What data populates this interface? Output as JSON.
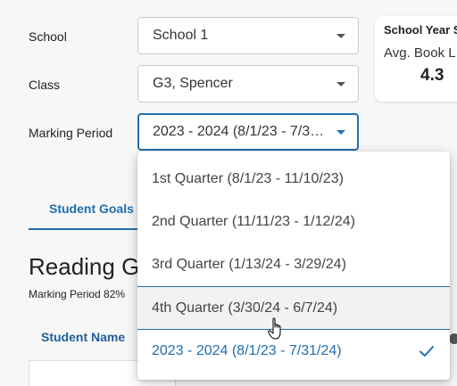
{
  "filters": {
    "school": {
      "label": "School",
      "value": "School 1"
    },
    "class": {
      "label": "Class",
      "value": "G3, Spencer"
    },
    "marking_period": {
      "label": "Marking Period",
      "value": "2023 - 2024 (8/1/23 - 7/31/24)"
    }
  },
  "summary_card": {
    "title": "School Year S",
    "subtitle": "Avg. Book L",
    "value": "4.3"
  },
  "tabs": {
    "active": {
      "label": "Student Goals"
    }
  },
  "section": {
    "title": "Reading G",
    "subtitle": "Marking Period 82%"
  },
  "table": {
    "column_header": "Student Name"
  },
  "dropdown": {
    "items": [
      {
        "label": "1st Quarter (8/1/23 - 11/10/23)",
        "state": "default"
      },
      {
        "label": "2nd Quarter (11/11/23 - 1/12/24)",
        "state": "default"
      },
      {
        "label": "3rd Quarter (1/13/24 - 3/29/24)",
        "state": "default"
      },
      {
        "label": "4th Quarter (3/30/24 - 6/7/24)",
        "state": "hovered"
      },
      {
        "label": "2023 - 2024 (8/1/23 - 7/31/24)",
        "state": "selected"
      }
    ]
  },
  "colors": {
    "accent": "#1f6fb0",
    "header_text": "#1f5f9a",
    "hover_bg": "#f2f2f2",
    "page_bg": "#f7f7f7"
  },
  "icons": {
    "select_caret": "caret-down-icon",
    "selected_check": "check-icon",
    "pointer": "hand-pointer-icon"
  }
}
